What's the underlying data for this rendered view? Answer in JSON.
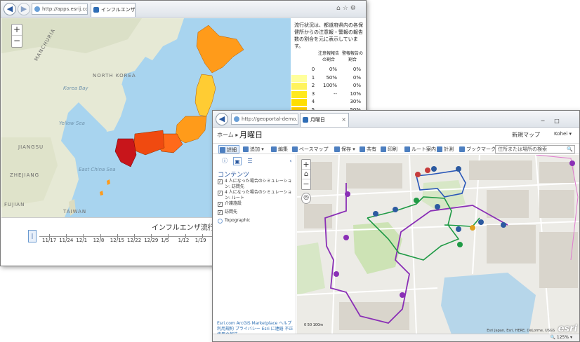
{
  "back_window": {
    "url": "http://apps.esrij.com/influe",
    "tab_title": "インフルエンザ",
    "map": {
      "zoom_in": "+",
      "zoom_out": "−",
      "labels": {
        "manchuria": "MANCHURIA",
        "north_korea": "NORTH KOREA",
        "korea_bay": "Korea Bay",
        "yellow_sea": "Yellow Sea",
        "jiangsu": "JIANGSU",
        "east_china_sea": "East China Sea",
        "zhejiang": "ZHEJIANG",
        "fujian": "FUJIAN",
        "taiwan": "TAIWAN"
      }
    },
    "legend": {
      "description": "流行状況は、都道府県内の各保健所からの注意報・警報の報告数の割合を元に表示しています。",
      "col_advisory": "注意報報告の割合",
      "col_warning": "警報報告の割合",
      "rows": [
        {
          "level": "0",
          "advisory": "0%",
          "warning": "0%",
          "color": "#ffffff"
        },
        {
          "level": "1",
          "advisory": "50%",
          "warning": "0%",
          "color": "#ffff9c"
        },
        {
          "level": "2",
          "advisory": "100%",
          "warning": "0%",
          "color": "#fff35c"
        },
        {
          "level": "3",
          "advisory": "--",
          "warning": "10%",
          "color": "#ffe91e"
        },
        {
          "level": "4",
          "advisory": "",
          "warning": "30%",
          "color": "#ffde00"
        },
        {
          "level": "5",
          "advisory": "",
          "warning": "50%",
          "color": "#ffd000"
        }
      ]
    },
    "timeline": {
      "title": "インフルエンザ流行マップ",
      "play": "|",
      "dates": [
        "11/17",
        "11/24",
        "12/1",
        "12/8",
        "12/15",
        "12/22",
        "12/29",
        "1/5",
        "1/12",
        "1/19"
      ]
    }
  },
  "front_window": {
    "url": "http://geoportal-demo.mapa",
    "tab_title": "月曜日",
    "header": {
      "home": "ホーム",
      "separator": "▸",
      "title": "月曜日",
      "new_map": "新規マップ",
      "user": "Kohei ▾"
    },
    "toolbar": {
      "details": "詳細",
      "add": "追加 ▾",
      "edit": "編集",
      "basemap": "ベースマップ",
      "save": "保存 ▾",
      "share": "共有",
      "print": "印刷",
      "route": "ルート案内",
      "measure": "計測",
      "bookmark": "ブックマーク",
      "search_placeholder": "住所または場所の検索"
    },
    "panel": {
      "title": "コンテンツ",
      "layers": [
        "4 人になった場合のシミュレーション: 訪問先",
        "4 人になった場合のシミュレーション: ルート",
        "介護施設",
        "訪問先",
        "Topographic"
      ],
      "footer": "Esri.com   ArcGIS Marketplace   ヘルプ   利用規約   プライバシー   Esri に連絡   不正使用の報告"
    },
    "map": {
      "attribution": "Esri Japan, Esri, HERE, DeLorme, USGS",
      "scale": "0      50     100m",
      "logo": "esri"
    },
    "status": {
      "zoom": "🔍 125%  ▾"
    }
  }
}
